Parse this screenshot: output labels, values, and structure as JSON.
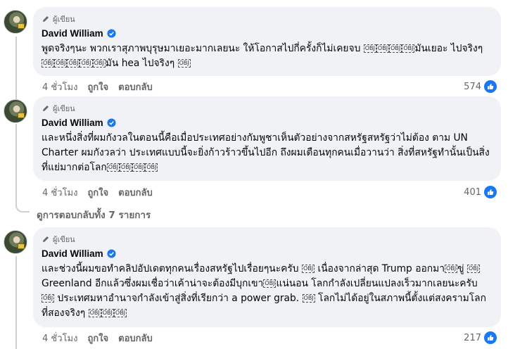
{
  "comments": [
    {
      "badge": "ผู้เขียน",
      "author": "David William",
      "text_parts": [
        "พูดจริงๆนะ พวกเราสุภาพบุรุษมาเยอะมากเลยนะ ให้โอกาสไปกี่ครั้งก็ไม่เคยจบ ",
        "มันเยอะ ไปจริงๆ ",
        "มัน hea ไปจริงๆ "
      ],
      "time": "4 ชั่วโมง",
      "like_label": "ถูกใจ",
      "reply_label": "ตอบกลับ",
      "likes": "574"
    },
    {
      "badge": "ผู้เขียน",
      "author": "David William",
      "text_parts": [
        "และหนึ่งสิ่งที่ผมกังวลในตอนนี้คือเมื่อประเทศอย่างกัมพูชาเห็นตัวอย่างจากสหรัฐสหรัฐว่าไม่ต้อง ตาม UN Charter ผมกังวลว่า ประเทศแบบนี้จะยิ่งก้าวร้าวขึ้นไปอีก ถึงผมเตือนทุกคนเมื่อวานว่า สิ่งที่สหรัฐทำนั้นเป็นสิ่งที่แย่มากต่อโลก"
      ],
      "time": "4 ชั่วโมง",
      "like_label": "ถูกใจ",
      "reply_label": "ตอบกลับ",
      "likes": "401"
    },
    {
      "badge": "ผู้เขียน",
      "author": "David William",
      "text_parts": [
        "และช่วงนี้ผมขอทำคลิปอัปเดตทุกคนเรื่องสหรัฐไปเรื่อยๆนะครับ ",
        " เนื่องจากล่าสุด Trump ออกมา",
        "ขู่ ",
        "Greenland อีกแล้วซึ่งผมเชื่อว่าเค้าน่าจะต้องมีบุกเขา",
        "แน่นอน โลกกำลังเปลี่ยนแปลงเร็วมากเลยนะครับ ",
        " ประเทศมหาอำนาจกำลังเข้าสู่สิ่งที่เรียกว่า a power grab. ",
        " โลกไม่ได้อยู่ในสภาพนี้ตั้งแต่สงครามโลกที่สองจริงๆ "
      ],
      "time": "4 ชั่วโมง",
      "like_label": "ถูกใจ",
      "reply_label": "ตอบกลับ",
      "likes": "217"
    }
  ],
  "obj_glyph": "OBJ",
  "view_replies": "ดูการตอบกลับทั้ง 7 รายการ",
  "colors": {
    "like_blue": "#1877f2",
    "bubble": "#f0f2f5",
    "secondary_text": "#65676b"
  },
  "icons": {
    "badge": "pen-icon",
    "verified": "verified-check-icon",
    "reaction": "like-thumb-icon"
  }
}
